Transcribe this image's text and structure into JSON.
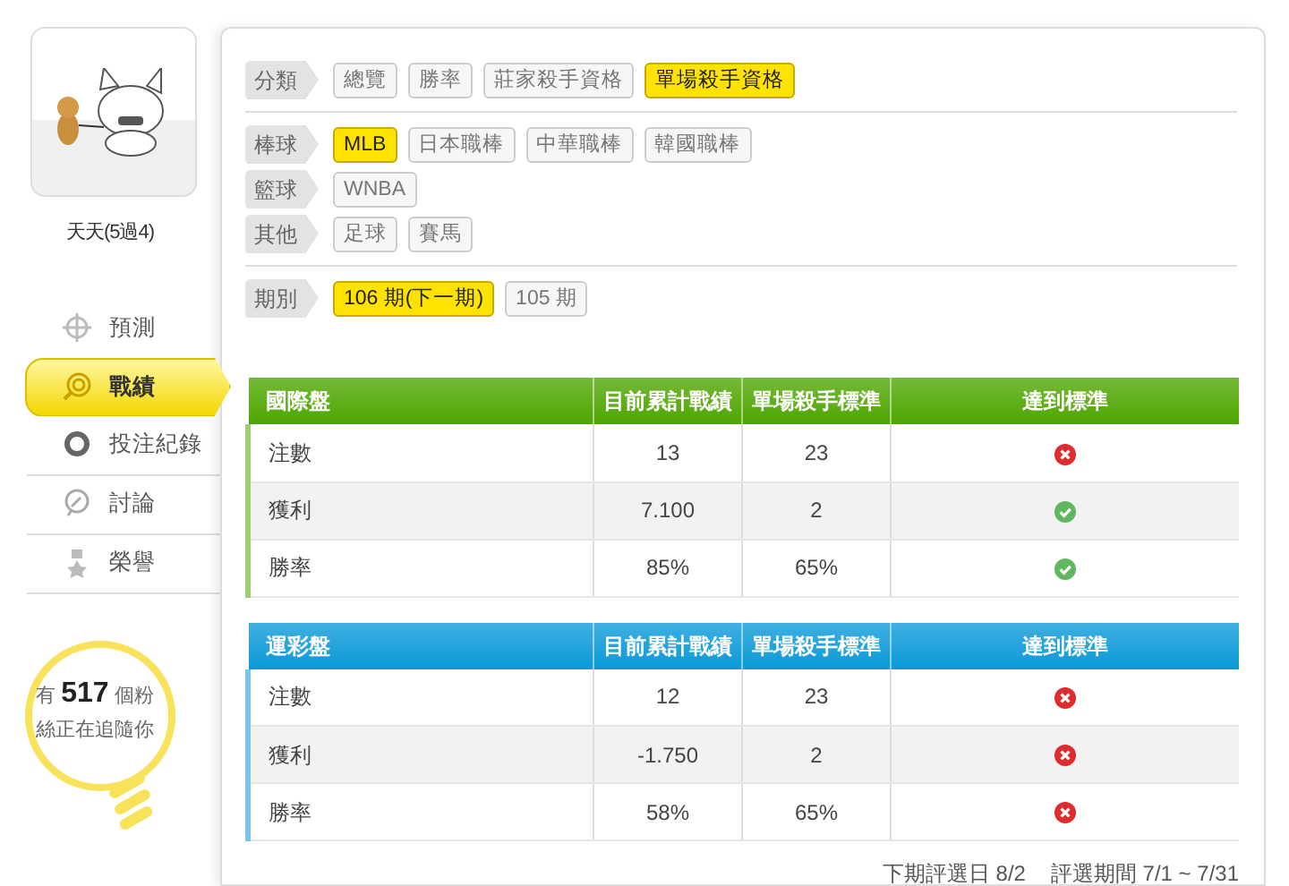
{
  "sidebar": {
    "user_name": "天天(5過4)",
    "menu": [
      {
        "label": "預測",
        "kind": "crosshair",
        "selected": false
      },
      {
        "label": "戰績",
        "kind": "target",
        "selected": true
      },
      {
        "label": "投注紀錄",
        "kind": "ring",
        "selected": false
      },
      {
        "label": "討論",
        "kind": "chat",
        "selected": false
      },
      {
        "label": "榮譽",
        "kind": "medal",
        "selected": false
      }
    ],
    "fans": "有 **517** 個粉絲正在追隨你"
  },
  "filter_sections": [
    [
      {
        "label": "分類",
        "options": [
          {
            "label": "總覽",
            "selected": false
          },
          {
            "label": "勝率",
            "selected": false
          },
          {
            "label": "莊家殺手資格",
            "selected": false
          },
          {
            "label": "單場殺手資格",
            "selected": true
          }
        ]
      }
    ],
    [
      {
        "label": "棒球",
        "options": [
          {
            "label": "MLB",
            "selected": true
          },
          {
            "label": "日本職棒",
            "selected": false
          },
          {
            "label": "中華職棒",
            "selected": false
          },
          {
            "label": "韓國職棒",
            "selected": false
          }
        ]
      },
      {
        "label": "籃球",
        "options": [
          {
            "label": "WNBA",
            "selected": false
          }
        ]
      },
      {
        "label": "其他",
        "options": [
          {
            "label": "足球",
            "selected": false
          },
          {
            "label": "賽馬",
            "selected": false
          }
        ]
      }
    ],
    [
      {
        "label": "期別",
        "options": [
          {
            "label": "106 期(下一期)",
            "selected": true
          },
          {
            "label": "105 期",
            "selected": false
          }
        ]
      }
    ]
  ],
  "tables": [
    {
      "color": "#4ea600",
      "columns": [
        "國際盤",
        "目前累計戰績",
        "單場殺手標準",
        "達到標準"
      ],
      "rows": [
        {
          "cells": [
            "注數",
            "13",
            "23"
          ],
          "met": false
        },
        {
          "cells": [
            "獲利",
            "7.100",
            "2"
          ],
          "met": true
        },
        {
          "cells": [
            "勝率",
            "85%",
            "65%"
          ],
          "met": true
        }
      ]
    },
    {
      "color": "#0a99d8",
      "columns": [
        "運彩盤",
        "目前累計戰績",
        "單場殺手標準",
        "達到標準"
      ],
      "rows": [
        {
          "cells": [
            "注數",
            "12",
            "23"
          ],
          "met": false
        },
        {
          "cells": [
            "獲利",
            "-1.750",
            "2"
          ],
          "met": false
        },
        {
          "cells": [
            "勝率",
            "58%",
            "65%"
          ],
          "met": false
        }
      ]
    }
  ],
  "footer": [
    "下期評選日 8/2",
    "評選期間 7/1 ~ 7/31"
  ]
}
